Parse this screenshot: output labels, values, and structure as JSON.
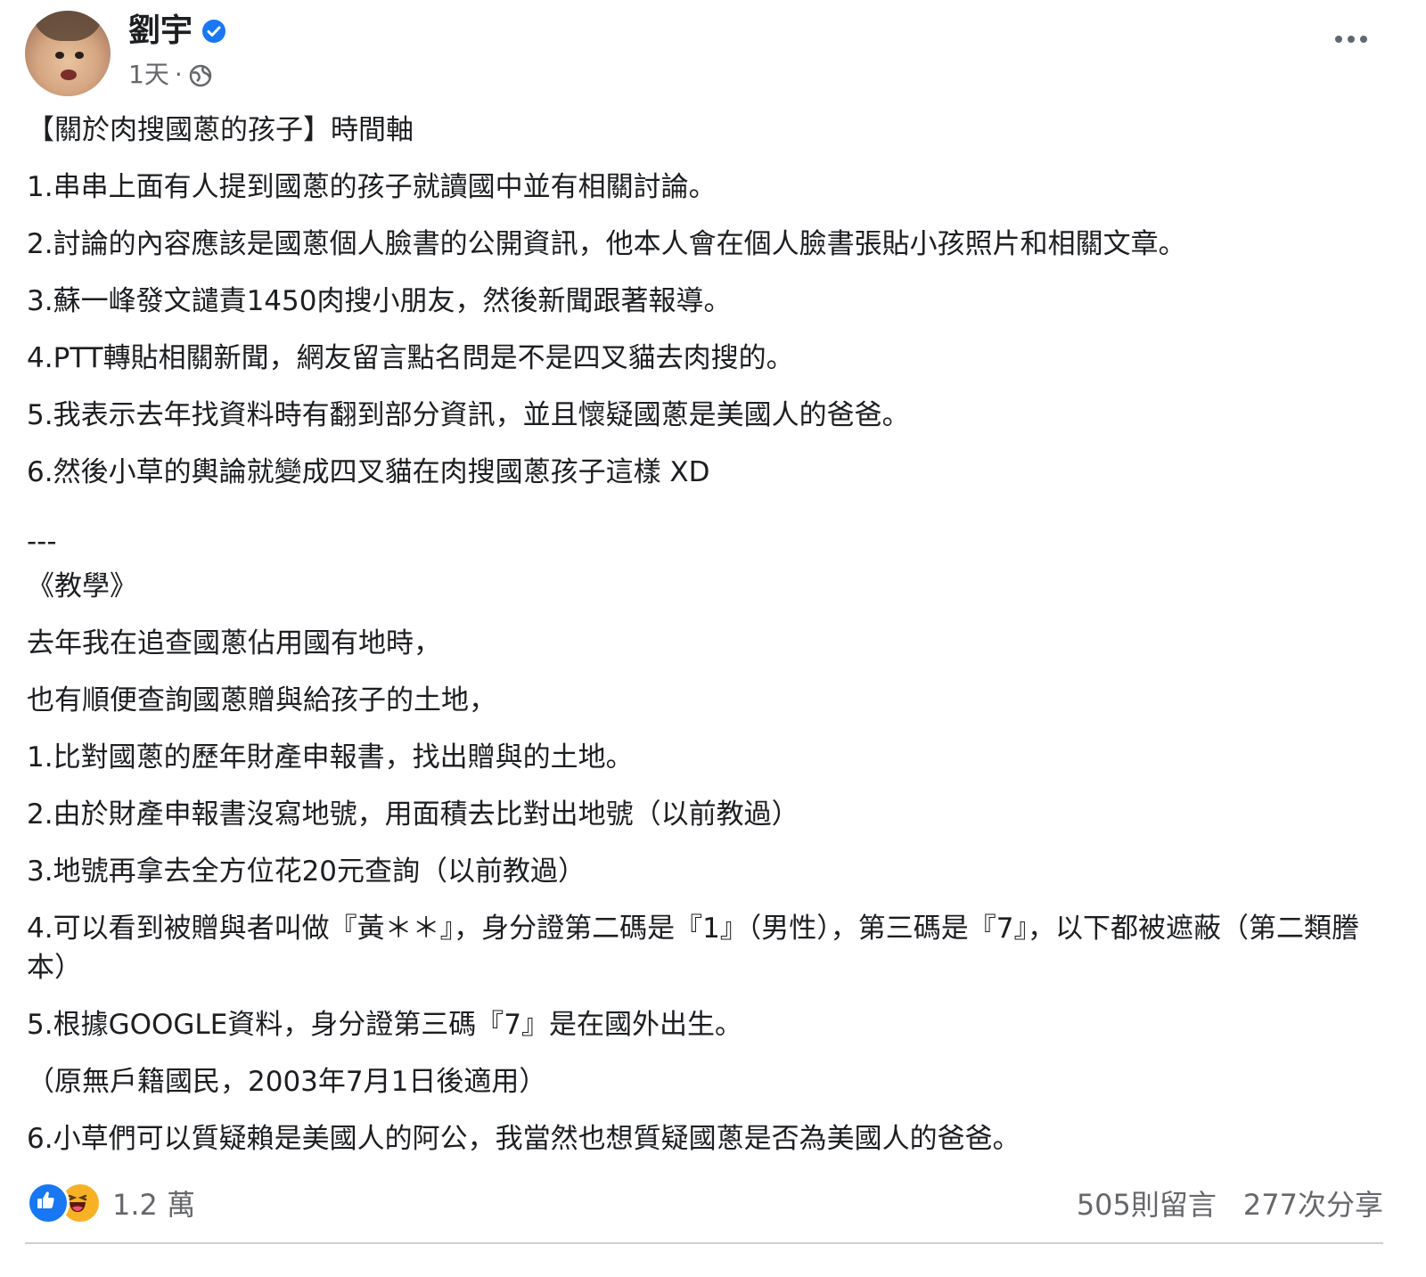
{
  "post": {
    "author": "劉宇",
    "time": "1天",
    "separator": "·",
    "title": "【關於肉搜國蔥的孩子】時間軸",
    "lines": [
      "1.串串上面有人提到國蔥的孩子就讀國中並有相關討論。",
      "2.討論的內容應該是國蔥個人臉書的公開資訊，他本人會在個人臉書張貼小孩照片和相關文章。",
      "3.蘇一峰發文譴責1450肉搜小朋友，然後新聞跟著報導。",
      "4.PTT轉貼相關新聞，網友留言點名問是不是四叉貓去肉搜的。",
      "5.我表示去年找資料時有翻到部分資訊，並且懷疑國蔥是美國人的爸爸。",
      "6.然後小草的輿論就變成四叉貓在肉搜國蔥孩子這樣 XD",
      "---",
      "《教學》",
      "去年我在追查國蔥佔用國有地時，",
      "也有順便查詢國蔥贈與給孩子的土地，",
      "1.比對國蔥的歷年財產申報書，找出贈與的土地。",
      "2.由於財產申報書沒寫地號，用面積去比對出地號（以前教過）",
      "3.地號再拿去全方位花20元查詢（以前教過）",
      "4.可以看到被贈與者叫做『黃＊＊』，身分證第二碼是『1』（男性），第三碼是『7』，以下都被遮蔽（第二類謄本）",
      "5.根據GOOGLE資料，身分證第三碼『7』是在國外出生。",
      "（原無戶籍國民，2003年7月1日後適用）",
      "6.小草們可以質疑賴是美國人的阿公，我當然也想質疑國蔥是否為美國人的爸爸。"
    ],
    "reactions_count": "1.2 萬",
    "comments": "505則留言",
    "shares": "277次分享",
    "colors": {
      "verified": "#1877f2",
      "like": "#1877f2",
      "haha": "#f7b125",
      "meta": "#65676b"
    },
    "icons": [
      "verified-icon",
      "globe-icon",
      "more-icon",
      "like-icon",
      "haha-icon"
    ]
  }
}
